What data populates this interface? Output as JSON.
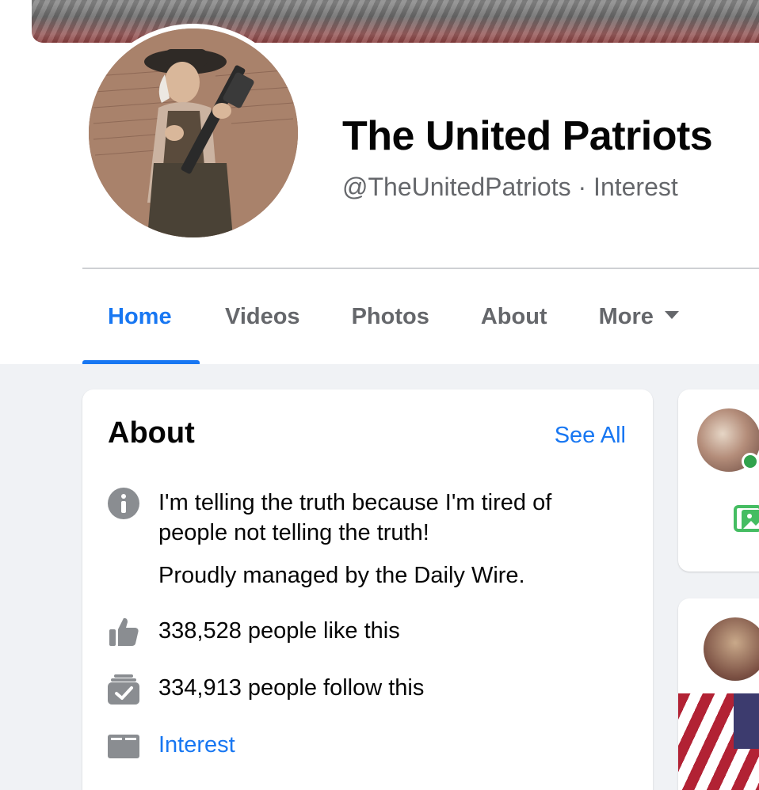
{
  "page": {
    "title": "The United Patriots",
    "handle": "@TheUnitedPatriots",
    "category": "Interest",
    "subtitle_separator": " · "
  },
  "tabs": [
    {
      "label": "Home",
      "active": true
    },
    {
      "label": "Videos",
      "active": false
    },
    {
      "label": "Photos",
      "active": false
    },
    {
      "label": "About",
      "active": false
    },
    {
      "label": "More",
      "active": false
    }
  ],
  "about": {
    "heading": "About",
    "see_all": "See All",
    "description_line1": "I'm telling the truth because I'm tired of",
    "description_line2": "people not telling the truth!",
    "managed_by": "Proudly managed by the Daily Wire.",
    "likes": "338,528 people like this",
    "follows": "334,913 people follow this",
    "category_link": "Interest"
  },
  "icons": {
    "info": "info-icon",
    "like": "thumbs-up-icon",
    "follow": "follow-check-icon",
    "category": "category-folder-icon",
    "more_caret": "caret-down-icon",
    "photo": "photo-icon"
  },
  "colors": {
    "accent": "#1877f2",
    "text_primary": "#050505",
    "text_secondary": "#65676b",
    "background": "#f0f2f5",
    "icon_gray": "#8a8d91",
    "online": "#31a24c",
    "photo_green": "#45bd62"
  }
}
